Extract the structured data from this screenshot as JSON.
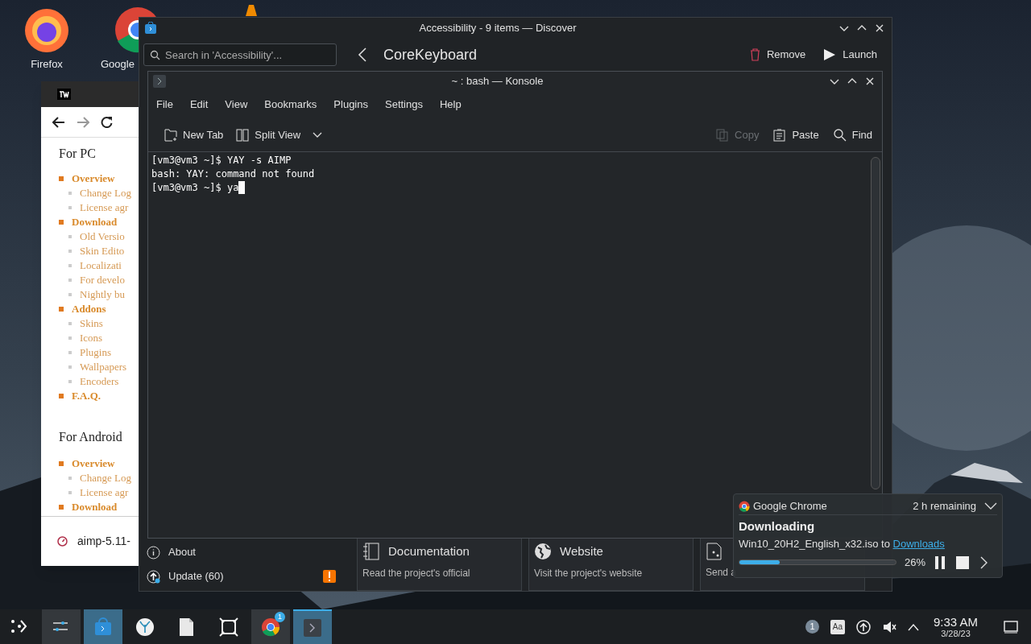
{
  "desktop_icons": [
    {
      "kind": "firefox",
      "label": "Firefox"
    },
    {
      "kind": "chrome",
      "label": "Google"
    },
    {
      "kind": "cone"
    }
  ],
  "browser": {
    "sections": [
      {
        "title": "For PC",
        "items": [
          {
            "label": "Overview",
            "children": [
              {
                "label": "Change Log"
              },
              {
                "label": "License agr"
              }
            ]
          },
          {
            "label": "Download",
            "children": [
              {
                "label": "Old Versio"
              },
              {
                "label": "Skin Edito"
              },
              {
                "label": "Localizati"
              },
              {
                "label": "For develo"
              },
              {
                "label": "Nightly bu"
              }
            ]
          },
          {
            "label": "Addons",
            "children": [
              {
                "label": "Skins"
              },
              {
                "label": "Icons"
              },
              {
                "label": "Plugins"
              },
              {
                "label": "Wallpapers"
              },
              {
                "label": "Encoders"
              }
            ]
          },
          {
            "label": "F.A.Q."
          }
        ]
      },
      {
        "title": "For Android",
        "items": [
          {
            "label": "Overview",
            "children": [
              {
                "label": "Change Log"
              },
              {
                "label": "License agr"
              }
            ]
          },
          {
            "label": "Download"
          }
        ]
      }
    ],
    "download": "aimp-5.11-"
  },
  "discover": {
    "title": "Accessibility - 9 items — Discover",
    "search": {
      "placeholder": "Search in 'Accessibility'..."
    },
    "app_name": "CoreKeyboard",
    "actions": [
      {
        "kind": "remove",
        "label": "Remove"
      },
      {
        "kind": "launch",
        "label": "Launch"
      }
    ],
    "sidebar_bottom": [
      {
        "kind": "about",
        "label": "About"
      },
      {
        "kind": "update",
        "label": "Update (60)",
        "warning": true
      }
    ],
    "cards": [
      {
        "kind": "doc",
        "title": "Documentation",
        "description": "Read the project's official"
      },
      {
        "kind": "web",
        "title": "Website",
        "description": "Visit the project's website"
      },
      {
        "kind": "share",
        "description": "Send a"
      }
    ]
  },
  "konsole": {
    "title": "~ : bash — Konsole",
    "menu": [
      "File",
      "Edit",
      "View",
      "Bookmarks",
      "Plugins",
      "Settings",
      "Help"
    ],
    "toolbar": [
      {
        "kind": "newtab",
        "label": "New Tab",
        "disabled": false
      },
      {
        "kind": "split",
        "label": "Split View",
        "disabled": false
      },
      {
        "kind": "copy",
        "label": "Copy",
        "disabled": true
      },
      {
        "kind": "paste",
        "label": "Paste",
        "disabled": false
      },
      {
        "kind": "find",
        "label": "Find",
        "disabled": false
      }
    ],
    "lines": [
      "[vm3@vm3 ~]$ YAY -s AIMP",
      "bash: YAY: command not found",
      "[vm3@vm3 ~]$ ya"
    ]
  },
  "notification": {
    "app": "Google Chrome",
    "remaining": "2 h remaining",
    "heading": "Downloading",
    "file": "Win10_20H2_English_x32.iso to ",
    "link": "Downloads",
    "level": 0.26,
    "percent": "26%"
  },
  "taskbar": {
    "tasks": [
      {
        "kind": "launcher",
        "open": false,
        "selected": false
      },
      {
        "kind": "settings",
        "open": true,
        "selected": false
      },
      {
        "kind": "discover",
        "open": true,
        "selected": false
      },
      {
        "kind": "coral",
        "open": false,
        "selected": false
      },
      {
        "kind": "file",
        "open": false,
        "selected": false
      },
      {
        "kind": "frame",
        "open": false,
        "selected": false
      },
      {
        "kind": "chrome",
        "open": true,
        "selected": false,
        "badge": "1"
      },
      {
        "kind": "konsole",
        "open": true,
        "selected": true
      }
    ],
    "tray": {
      "badge": "1",
      "keyboard": "Aa"
    },
    "time": "9:33 AM",
    "date": "3/28/23"
  }
}
